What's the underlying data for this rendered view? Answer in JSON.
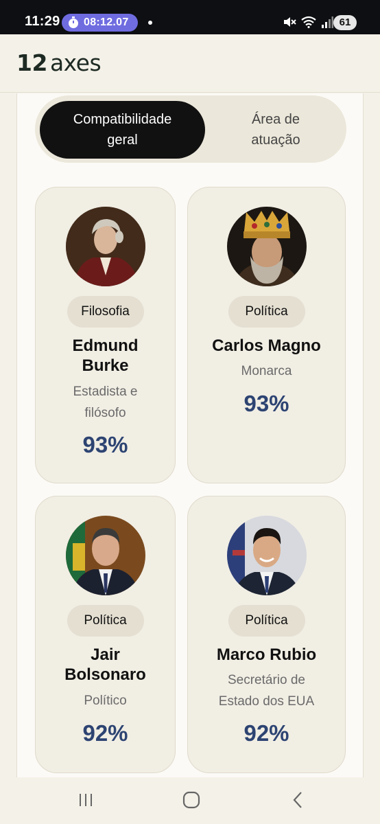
{
  "status_bar": {
    "time": "11:29",
    "timer": "08:12.07",
    "battery": "61"
  },
  "header": {
    "logo_number": "12",
    "logo_text": "axes"
  },
  "tabs": [
    {
      "label": "Compatibilidade\ngeral",
      "active": true
    },
    {
      "label": "Área de\natuação",
      "active": false
    }
  ],
  "cards": [
    {
      "category": "Filosofia",
      "name": "Edmund\nBurke",
      "role": "Estadista e\nfilósofo",
      "percent": "93%"
    },
    {
      "category": "Política",
      "name": "Carlos Magno",
      "role": "Monarca",
      "percent": "93%"
    },
    {
      "category": "Política",
      "name": "Jair\nBolsonaro",
      "role": "Político",
      "percent": "92%"
    },
    {
      "category": "Política",
      "name": "Marco Rubio",
      "role": "Secretário de\nEstado dos EUA",
      "percent": "92%"
    }
  ],
  "colors": {
    "accent_text": "#2d4472",
    "active_tab": "#111111",
    "background": "#f4f1e8",
    "card": "#f1eee4",
    "timer_pill": "#6f6ce0"
  }
}
